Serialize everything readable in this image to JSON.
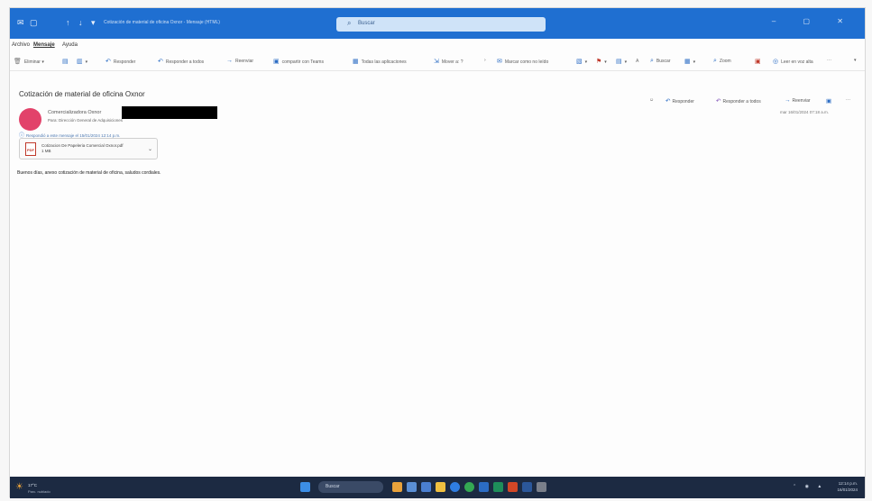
{
  "window": {
    "title": "Cotización de material de oficina Oxnor - Mensaje (HTML)",
    "search_placeholder": "Buscar"
  },
  "menu": [
    {
      "label": "Archivo"
    },
    {
      "label": "Mensaje",
      "active": true
    },
    {
      "label": "Ayuda"
    }
  ],
  "ribbon": {
    "delete": "Eliminar",
    "reply": "Responder",
    "reply_all": "Responder a todos",
    "forward": "Reenviar",
    "teams": "compartir con Teams",
    "quick_steps": "Todas las aplicaciones",
    "move": "Mover a: ?",
    "mark_unread": "Marcar como no leído",
    "find": "Buscar",
    "zoom": "Zoom",
    "read_aloud": "Leer en voz alta",
    "more": "···"
  },
  "message": {
    "subject": "Cotización de material de oficina Oxnor",
    "sender": "Comercializadora Oxnor",
    "to": "Para: Dirección General de Adquisiciones",
    "reply_note": "Respondió a este mensaje el 15/01/2024 12:14 p.m.",
    "attachment_name": "Cotizacion De Papeleria Comercial Oxnor.pdf",
    "attachment_size": "1 MB",
    "body": "Buenos días, anexo cotización de material de oficina, saludos cordiales.",
    "timestamp": "mar 16/01/2024 07:18 a.m."
  },
  "actions": {
    "reply": "Responder",
    "reply_all": "Responder a todos",
    "forward": "Reenviar"
  },
  "taskbar": {
    "weather_temp": "17°C",
    "weather_desc": "Parc. nublado",
    "search": "Buscar",
    "time": "12:14 p.m.",
    "date": "16/01/2024"
  },
  "colors": {
    "titlebar": "#1f6fd1",
    "avatar": "#e2426a",
    "taskbar": "#1c2a42"
  }
}
